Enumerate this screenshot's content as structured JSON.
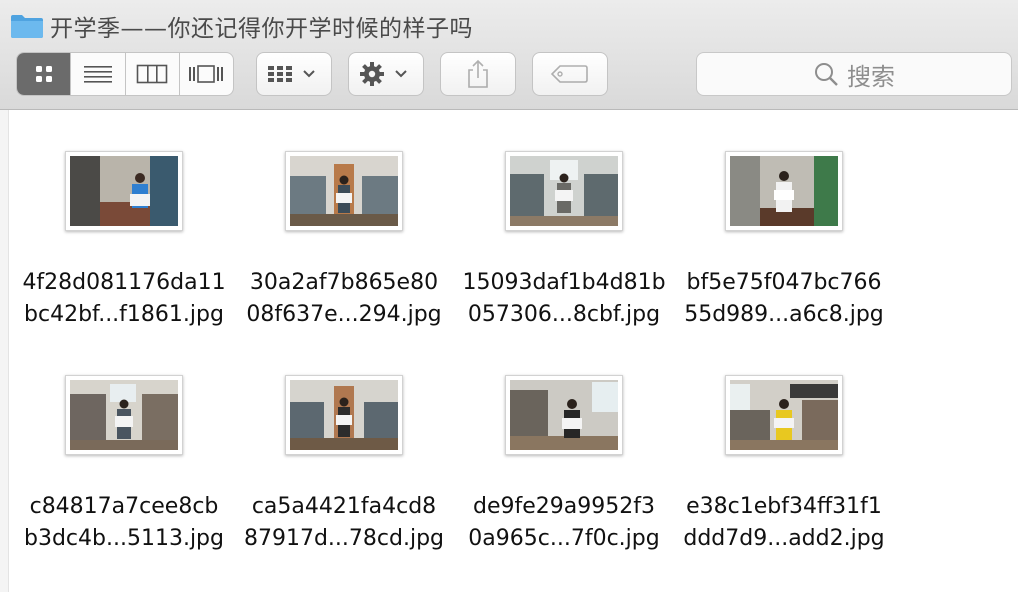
{
  "window": {
    "title": "开学季——你还记得你开学时候的样子吗",
    "folder_icon": "folder-icon"
  },
  "toolbar": {
    "view_modes": [
      {
        "name": "icon-view",
        "icon": "grid-icon",
        "active": true
      },
      {
        "name": "list-view",
        "icon": "list-icon",
        "active": false
      },
      {
        "name": "column-view",
        "icon": "columns-icon",
        "active": false
      },
      {
        "name": "cover-flow-view",
        "icon": "coverflow-icon",
        "active": false
      }
    ],
    "arrange_icon": "arrange-grid-icon",
    "action_icon": "gear-icon",
    "share_icon": "share-icon",
    "tag_icon": "tag-icon",
    "search_placeholder": "搜索"
  },
  "files": [
    {
      "line1": "4f28d081176da11",
      "line2": "bc42bf...f1861.jpg"
    },
    {
      "line1": "30a2af7b865e80",
      "line2": "08f637e...294.jpg"
    },
    {
      "line1": "15093daf1b4d81b",
      "line2": "057306...8cbf.jpg"
    },
    {
      "line1": "bf5e75f047bc766",
      "line2": "55d989...a6c8.jpg"
    },
    {
      "line1": "c84817a7cee8cb",
      "line2": "b3dc4b...5113.jpg"
    },
    {
      "line1": "ca5a4421fa4cd8",
      "line2": "87917d...78cd.jpg"
    },
    {
      "line1": "de9fe29a9952f3",
      "line2": "0a965c...7f0c.jpg"
    },
    {
      "line1": "e38c1ebf34ff31f1",
      "line2": "ddd7d9...add2.jpg"
    }
  ],
  "colors": {
    "folder_blue": "#4fa3e0",
    "active_segment": "#6b6b6b"
  }
}
